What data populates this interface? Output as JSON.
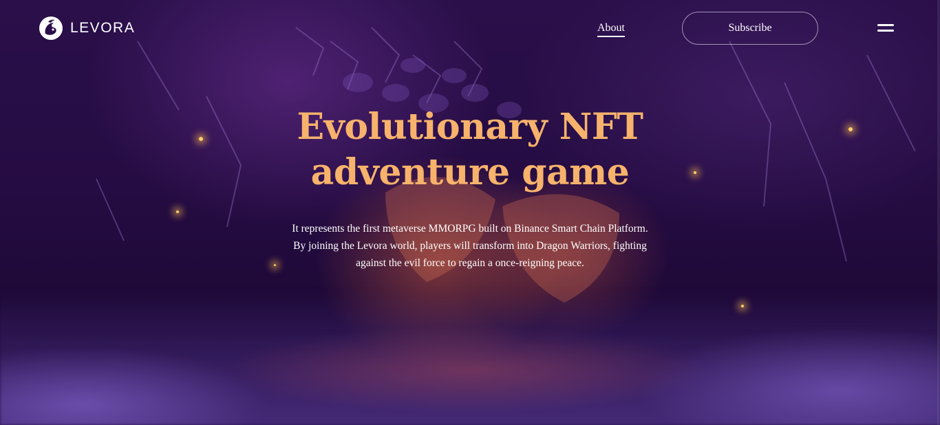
{
  "brand": {
    "name": "LEVORA",
    "logo_icon": "dragon-logo-icon"
  },
  "nav": {
    "about_label": "About",
    "subscribe_label": "Subscribe",
    "menu_icon": "hamburger-menu-icon"
  },
  "hero": {
    "title_line1": "Evolutionary NFT",
    "title_line2": "adventure game",
    "description_lines": [
      "It represents the first metaverse MMORPG built on Binance Smart Chain Platform.",
      "By joining the Levora world, players will transform into Dragon Warriors, fighting",
      "against the evil force to regain a once-reigning peace."
    ]
  },
  "colors": {
    "title": "#f7b36c",
    "text": "#ffffff",
    "background": "#250c42"
  }
}
